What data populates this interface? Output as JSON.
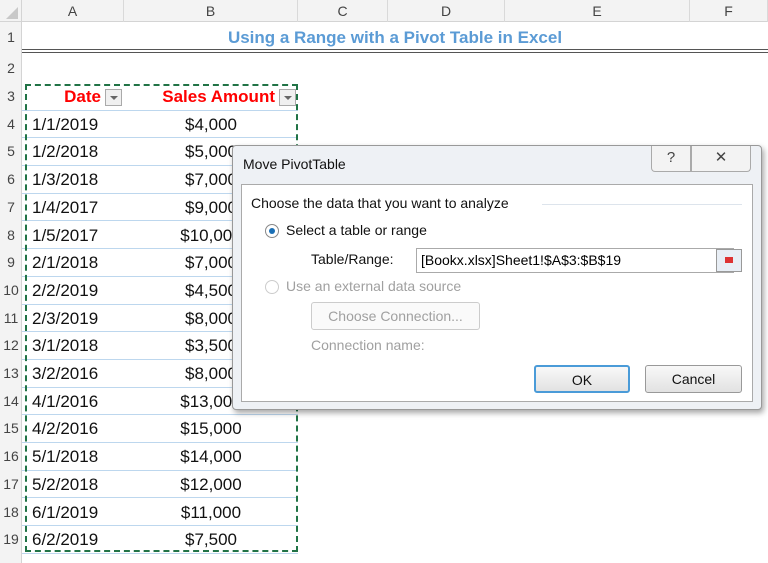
{
  "columns": [
    "A",
    "B",
    "C",
    "D",
    "E",
    "F"
  ],
  "title": "Using a Range with a Pivot Table in Excel",
  "headers": {
    "date": "Date",
    "amount": "Sales Amount"
  },
  "rows": [
    {
      "date": "1/1/2019",
      "amount": "$4,000"
    },
    {
      "date": "1/2/2018",
      "amount": "$5,000"
    },
    {
      "date": "1/3/2018",
      "amount": "$7,000"
    },
    {
      "date": "1/4/2017",
      "amount": "$9,000"
    },
    {
      "date": "1/5/2017",
      "amount": "$10,000"
    },
    {
      "date": "2/1/2018",
      "amount": "$7,000"
    },
    {
      "date": "2/2/2019",
      "amount": "$4,500"
    },
    {
      "date": "2/3/2019",
      "amount": "$8,000"
    },
    {
      "date": "3/1/2018",
      "amount": "$3,500"
    },
    {
      "date": "3/2/2016",
      "amount": "$8,000"
    },
    {
      "date": "4/1/2016",
      "amount": "$13,000"
    },
    {
      "date": "4/2/2016",
      "amount": "$15,000"
    },
    {
      "date": "5/1/2018",
      "amount": "$14,000"
    },
    {
      "date": "5/2/2018",
      "amount": "$12,000"
    },
    {
      "date": "6/1/2019",
      "amount": "$11,000"
    },
    {
      "date": "6/2/2019",
      "amount": "$7,500"
    }
  ],
  "dialog": {
    "title": "Move PivotTable",
    "help": "?",
    "close": "✕",
    "group_label": "Choose the data that you want to analyze",
    "option_select": "Select a table or range",
    "range_label": "Table/Range:",
    "range_value": "[Bookx.xlsx]Sheet1!$A$3:$B$19",
    "option_external": "Use an external data source",
    "choose_connection": "Choose Connection...",
    "connection_name": "Connection name:",
    "ok": "OK",
    "cancel": "Cancel"
  },
  "colors": {
    "title": "#5b9bd5",
    "header": "#ff0000",
    "marquee": "#217346"
  }
}
